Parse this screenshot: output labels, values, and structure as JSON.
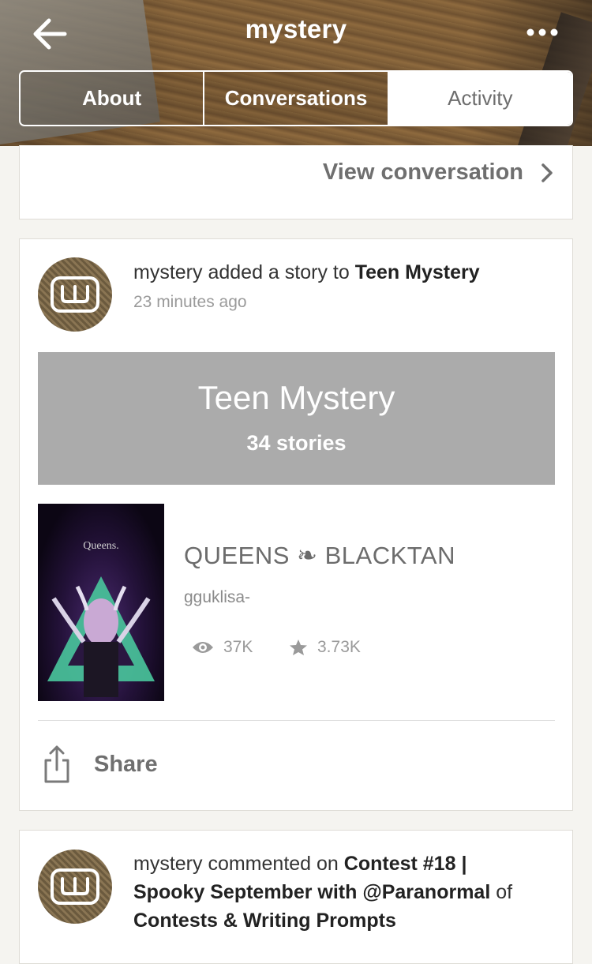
{
  "header": {
    "title": "mystery",
    "tabs": [
      {
        "label": "About"
      },
      {
        "label": "Conversations"
      },
      {
        "label": "Activity"
      }
    ]
  },
  "conversation_card": {
    "view_label": "View conversation"
  },
  "activity": {
    "actor": "mystery",
    "action": "added a story to",
    "target": "Teen Mystery",
    "time": "23 minutes ago",
    "list": {
      "title": "Teen Mystery",
      "count": "34 stories"
    },
    "story": {
      "cover_title": "Queens.",
      "title": "QUEENS ❧ BLACKTAN",
      "author": "gguklisa-",
      "reads": "37K",
      "votes": "3.73K"
    },
    "share_label": "Share"
  },
  "activity2": {
    "actor": "mystery",
    "action": "commented on",
    "target": "Contest #18 | Spooky September with @Paranormal",
    "of": "of",
    "group": "Contests & Writing Prompts"
  },
  "colors": {
    "accent_gray": "#ababab",
    "text_gray": "#6f6f6f",
    "brand_brown": "#7a6748"
  },
  "icons": [
    "back-arrow-icon",
    "more-dots-icon",
    "chevron-right-icon",
    "wattpad-logo-icon",
    "eye-icon",
    "star-icon",
    "share-icon"
  ]
}
